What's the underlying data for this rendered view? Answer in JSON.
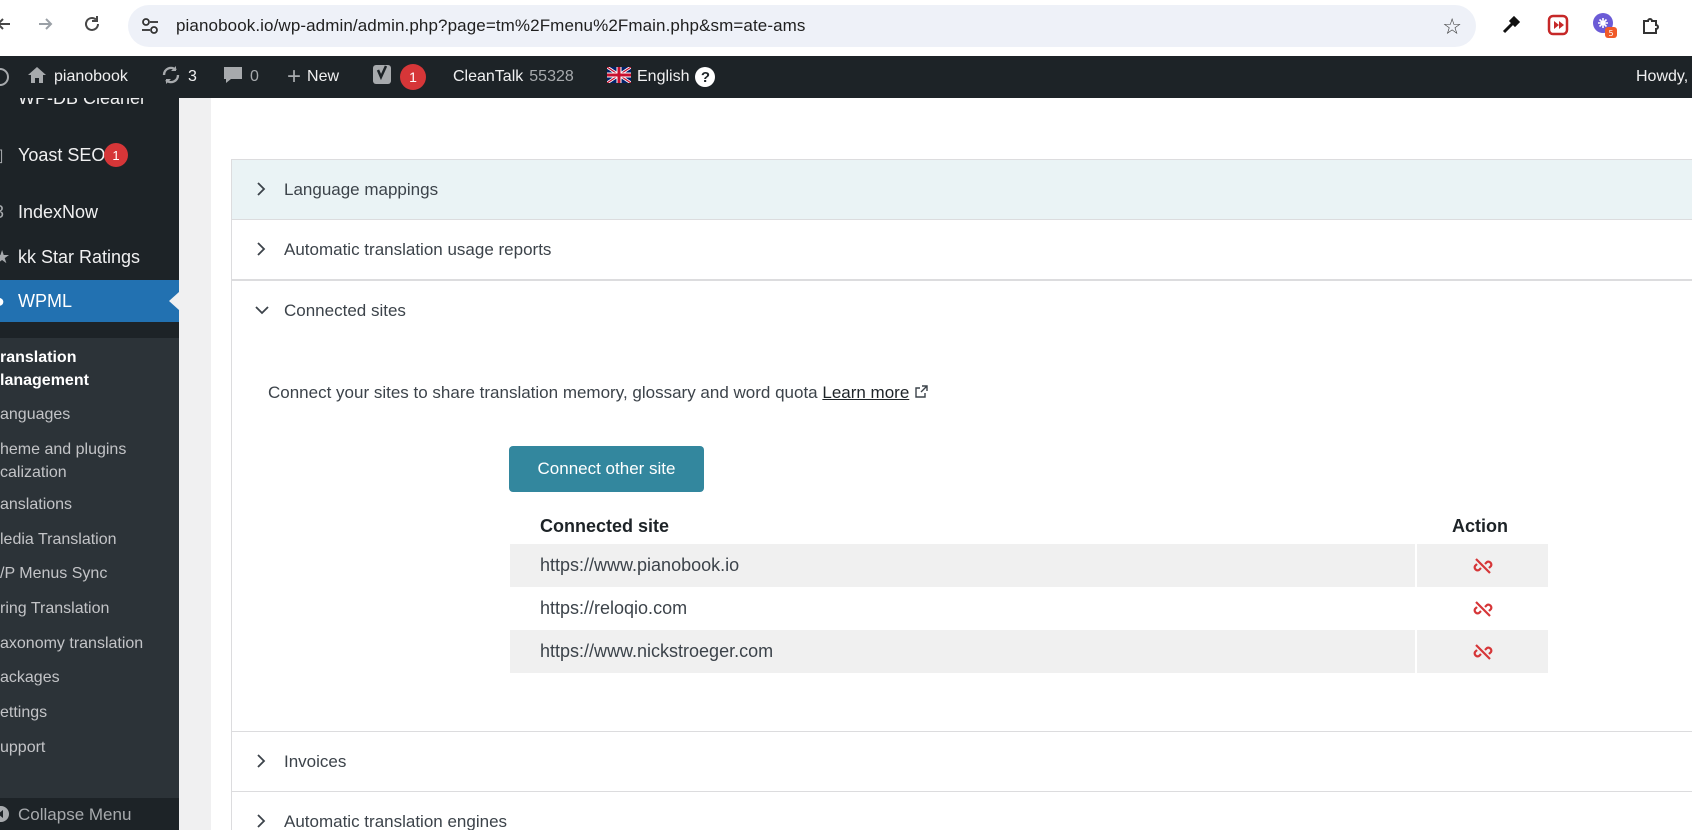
{
  "browser": {
    "url": "pianobook.io/wp-admin/admin.php?page=tm%2Fmenu%2Fmain.php&sm=ate-ams",
    "icons": [
      "back-icon",
      "forward-icon",
      "reload-icon",
      "site-info-icon",
      "bookmark-star-icon",
      "eyedropper-icon",
      "extension-red-icon",
      "extension-purple-icon",
      "extensions-puzzle-icon"
    ],
    "extension_badge": "5"
  },
  "adminbar": {
    "site_name": "pianobook",
    "updates_count": "3",
    "comments_count": "0",
    "new_label": "New",
    "yoast_count": "1",
    "cleantalk_label": "CleanTalk",
    "cleantalk_count": "55328",
    "language_label": "English",
    "help_label": "?",
    "howdy_label": "Howdy,"
  },
  "sidebar": {
    "top_items": [
      {
        "label": "WP-DB Cleaner"
      },
      {
        "label": "Yoast SEO",
        "badge": "1"
      },
      {
        "label": "IndexNow"
      },
      {
        "label": "kk Star Ratings"
      },
      {
        "label": "WPML"
      }
    ],
    "submenu": [
      {
        "label": "ranslation"
      },
      {
        "label": "lanagement"
      },
      {
        "label": "anguages"
      },
      {
        "label": "heme and plugins"
      },
      {
        "label": "calization"
      },
      {
        "label": "anslations"
      },
      {
        "label": "ledia Translation"
      },
      {
        "label": "/P Menus Sync"
      },
      {
        "label": "ring Translation"
      },
      {
        "label": "axonomy translation"
      },
      {
        "label": "ackages"
      },
      {
        "label": "ettings"
      },
      {
        "label": "upport"
      }
    ],
    "collapse_label": "Collapse Menu"
  },
  "sections": [
    {
      "label": "Language mappings",
      "expanded": false
    },
    {
      "label": "Automatic translation usage reports",
      "expanded": false
    },
    {
      "label": "Connected sites",
      "expanded": true
    },
    {
      "label": "Invoices",
      "expanded": false
    },
    {
      "label": "Automatic translation engines",
      "expanded": false
    }
  ],
  "connected_sites": {
    "description": "Connect your sites to share translation memory, glossary and word quota",
    "learn_more": "Learn more",
    "connect_button": "Connect other site",
    "col_site": "Connected site",
    "col_action": "Action",
    "rows": [
      {
        "site": "https://www.pianobook.io"
      },
      {
        "site": "https://reloqio.com"
      },
      {
        "site": "https://www.nickstroeger.com"
      }
    ]
  },
  "colors": {
    "admin_bar": "#1d2327",
    "sidebar_active": "#2271b1",
    "button": "#33879e",
    "unlink_icon": "#d63638",
    "badge": "#d63638"
  }
}
